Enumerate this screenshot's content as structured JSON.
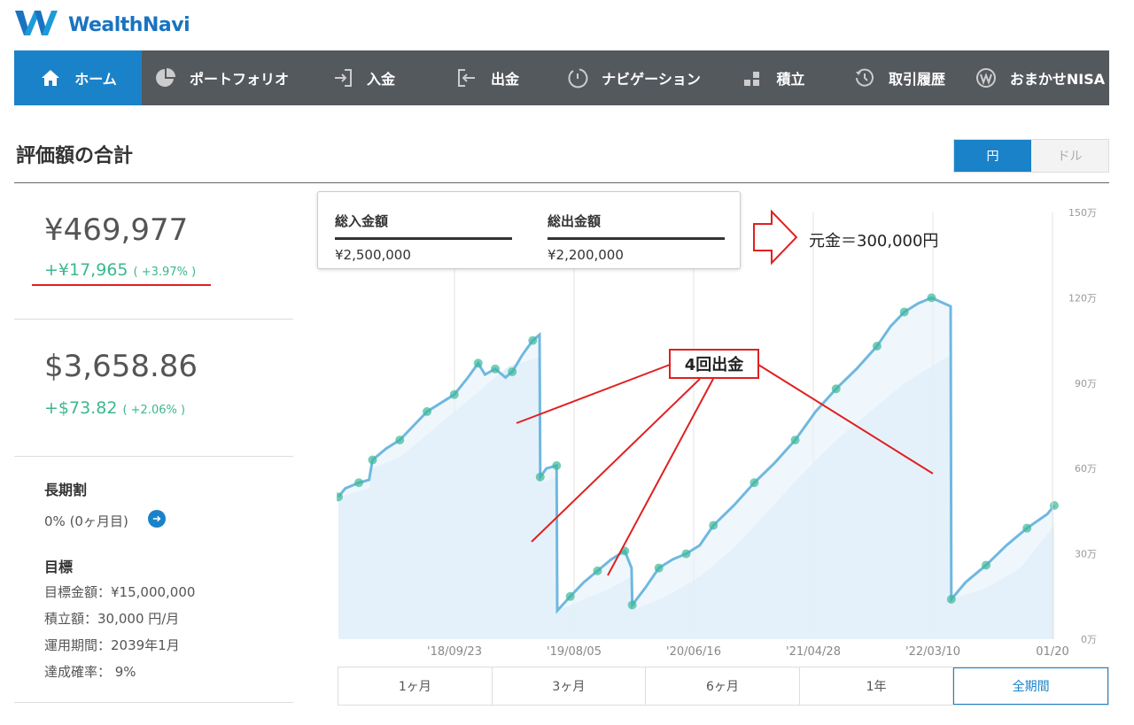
{
  "app": {
    "logo_text": "WealthNavi"
  },
  "nav": [
    {
      "label": "ホーム",
      "icon": "home-icon",
      "active": true
    },
    {
      "label": "ポートフォリオ",
      "icon": "pie-chart-icon"
    },
    {
      "label": "入金",
      "icon": "deposit-icon"
    },
    {
      "label": "出金",
      "icon": "withdraw-icon"
    },
    {
      "label": "ナビゲーション",
      "icon": "navigation-icon"
    },
    {
      "label": "積立",
      "icon": "accumulate-icon"
    },
    {
      "label": "取引履歴",
      "icon": "history-icon"
    },
    {
      "label": "おまかせNISA",
      "icon": "nisa-icon"
    }
  ],
  "page": {
    "title": "評価額の合計"
  },
  "currency": {
    "yen": "円",
    "dollar": "ドル",
    "selected": "円"
  },
  "summary": {
    "jpy": {
      "amount": "¥469,977",
      "gain": "+¥17,965",
      "gain_pct": "( +3.97% )"
    },
    "usd": {
      "amount": "$3,658.86",
      "gain": "+$73.82",
      "gain_pct": "( +2.06% )"
    }
  },
  "long_term": {
    "label": "長期割",
    "value": "0% (0ヶ月目)"
  },
  "goal": {
    "label": "目標",
    "items": [
      "目標金額：¥15,000,000",
      "積立額：30,000 円/月",
      "運用期間：2039年1月",
      "達成確率： 9%"
    ]
  },
  "tooltip": {
    "deposit_label": "総入金額",
    "deposit_value": "¥2,500,000",
    "withdraw_label": "総出金額",
    "withdraw_value": "¥2,200,000"
  },
  "annotations": {
    "principal": "元金＝300,000円",
    "withdrawals": "4回出金"
  },
  "periods": [
    {
      "label": "1ヶ月"
    },
    {
      "label": "3ヶ月"
    },
    {
      "label": "6ヶ月"
    },
    {
      "label": "1年"
    },
    {
      "label": "全期間",
      "active": true
    }
  ],
  "chart_data": {
    "type": "area",
    "x_ticks": [
      "'18/09/23",
      "'19/08/05",
      "'20/06/16",
      "'21/04/28",
      "'22/03/10",
      "01/20"
    ],
    "y_ticks": [
      "0万",
      "30万",
      "60万",
      "90万",
      "120万",
      "150万"
    ],
    "ylim": [
      0,
      150
    ],
    "grid": true,
    "series": [
      {
        "kind": "valuation",
        "color": "#6fb8e0",
        "points": [
          [
            0,
            50
          ],
          [
            0.1,
            53
          ],
          [
            0.3,
            55
          ],
          [
            0.45,
            56
          ],
          [
            0.5,
            63
          ],
          [
            0.7,
            67
          ],
          [
            0.9,
            70
          ],
          [
            1.1,
            75
          ],
          [
            1.3,
            80
          ],
          [
            1.5,
            83
          ],
          [
            1.7,
            86
          ],
          [
            1.9,
            92
          ],
          [
            2.05,
            97
          ],
          [
            2.15,
            93
          ],
          [
            2.3,
            95
          ],
          [
            2.45,
            92
          ],
          [
            2.55,
            94
          ],
          [
            2.7,
            100
          ],
          [
            2.85,
            105
          ],
          [
            2.95,
            107
          ],
          [
            2.96,
            57
          ],
          [
            3.05,
            60
          ],
          [
            3.2,
            61
          ],
          [
            3.21,
            10
          ],
          [
            3.4,
            15
          ],
          [
            3.6,
            20
          ],
          [
            3.8,
            24
          ],
          [
            4.0,
            28
          ],
          [
            4.2,
            31
          ],
          [
            4.3,
            25
          ],
          [
            4.31,
            12
          ],
          [
            4.5,
            18
          ],
          [
            4.7,
            25
          ],
          [
            4.9,
            28
          ],
          [
            5.1,
            30
          ],
          [
            5.3,
            33
          ],
          [
            5.5,
            40
          ],
          [
            5.8,
            47
          ],
          [
            6.1,
            55
          ],
          [
            6.4,
            62
          ],
          [
            6.7,
            70
          ],
          [
            7.0,
            80
          ],
          [
            7.3,
            88
          ],
          [
            7.6,
            95
          ],
          [
            7.9,
            103
          ],
          [
            8.1,
            110
          ],
          [
            8.3,
            115
          ],
          [
            8.5,
            118
          ],
          [
            8.7,
            120
          ],
          [
            8.98,
            117
          ],
          [
            8.99,
            14
          ],
          [
            9.2,
            20
          ],
          [
            9.5,
            26
          ],
          [
            9.8,
            33
          ],
          [
            10.1,
            39
          ],
          [
            10.4,
            44
          ],
          [
            10.5,
            47
          ]
        ]
      },
      {
        "kind": "principal",
        "color": "#d6ebf7",
        "points": [
          [
            0,
            50
          ],
          [
            0.3,
            52
          ],
          [
            0.45,
            53
          ],
          [
            0.5,
            60
          ],
          [
            0.9,
            64
          ],
          [
            1.3,
            72
          ],
          [
            1.7,
            80
          ],
          [
            2.1,
            88
          ],
          [
            2.5,
            96
          ],
          [
            2.95,
            99
          ],
          [
            2.96,
            55
          ],
          [
            3.2,
            57
          ],
          [
            3.21,
            10
          ],
          [
            3.6,
            14
          ],
          [
            4.0,
            18
          ],
          [
            4.3,
            22
          ],
          [
            4.31,
            10
          ],
          [
            4.8,
            15
          ],
          [
            5.3,
            22
          ],
          [
            5.8,
            32
          ],
          [
            6.3,
            45
          ],
          [
            6.8,
            58
          ],
          [
            7.3,
            70
          ],
          [
            7.8,
            80
          ],
          [
            8.3,
            90
          ],
          [
            8.98,
            100
          ],
          [
            8.99,
            14
          ],
          [
            9.5,
            18
          ],
          [
            10.0,
            25
          ],
          [
            10.5,
            40
          ]
        ]
      }
    ]
  }
}
